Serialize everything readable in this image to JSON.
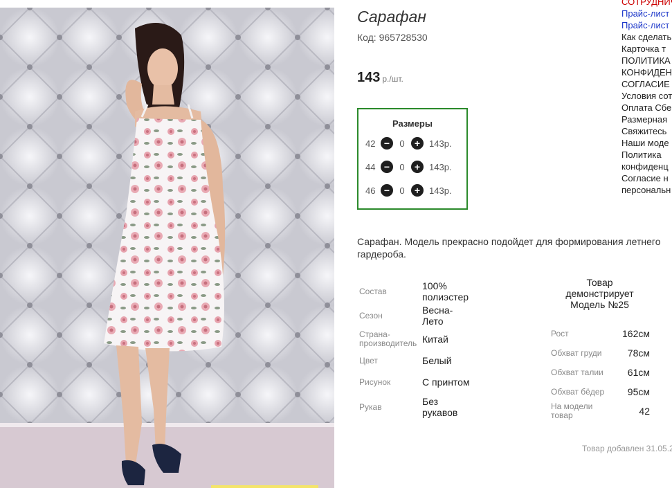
{
  "product": {
    "title": "Сарафан",
    "code": "Код: 965728530",
    "price": "143",
    "price_unit": "р./шт.",
    "image_alt": "photo of model wearing floral dress"
  },
  "sizes": {
    "header": "Размеры",
    "rows": [
      {
        "size": "42",
        "qty": "0",
        "price": "143р."
      },
      {
        "size": "44",
        "qty": "0",
        "price": "143р."
      },
      {
        "size": "46",
        "qty": "0",
        "price": "143р."
      }
    ],
    "minus_icon": "minus-circle-icon",
    "plus_icon": "plus-circle-icon"
  },
  "sidebar": {
    "links": [
      "СОТРУДНИЧ",
      "Прайс-лист",
      "Прайс-лист",
      "Как сделать",
      "Карточка т",
      "ПОЛИТИКА",
      "КОНФИДЕН",
      "СОГЛАСИЕ",
      "Условия сот",
      "Оплата Сбе",
      "Размерная",
      "Свяжитесь",
      "Наши моде",
      "Политика",
      "конфиденц",
      "Согласие н",
      "персональн"
    ]
  },
  "description": "Сарафан. Модель прекрасно подойдет для формирования летнего гардероба.",
  "properties": [
    {
      "key": "Состав",
      "value": "100% полиэстер"
    },
    {
      "key": "Сезон",
      "value": "Весна-Лето"
    },
    {
      "key": "Страна-производитель",
      "value": "Китай"
    },
    {
      "key": "Цвет",
      "value": "Белый"
    },
    {
      "key": "Рисунок",
      "value": "С принтом"
    },
    {
      "key": "Рукав",
      "value": "Без рукавов"
    }
  ],
  "model": {
    "heading": "Товар демонстрирует Модель №25",
    "rows": [
      {
        "key": "Рост",
        "value": "162см"
      },
      {
        "key": "Обхват груди",
        "value": "78см"
      },
      {
        "key": "Обхват талии",
        "value": "61см"
      },
      {
        "key": "Обхват бёдер",
        "value": "95см"
      },
      {
        "key": "На модели товар",
        "value": "42"
      }
    ]
  },
  "added": "Товар добавлен 31.05.2",
  "colors": {
    "sizes_border": "#2b8a2b",
    "link_red": "#cc0000",
    "link_blue": "#1a35c9"
  }
}
